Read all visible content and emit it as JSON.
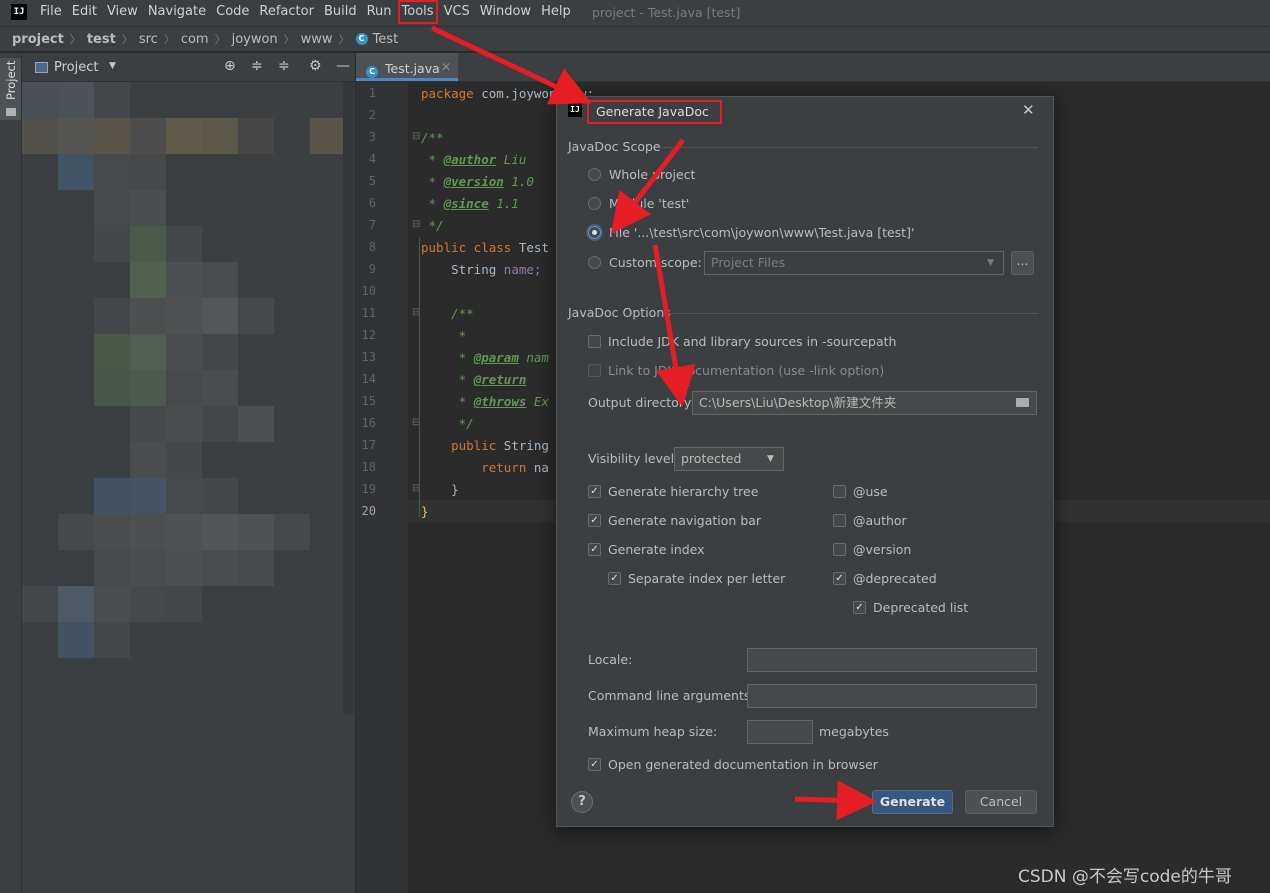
{
  "menubar": {
    "items": [
      "File",
      "Edit",
      "View",
      "Navigate",
      "Code",
      "Refactor",
      "Build",
      "Run",
      "Tools",
      "VCS",
      "Window",
      "Help"
    ],
    "window_title": "project - Test.java [test]"
  },
  "breadcrumb": {
    "items": [
      "project",
      "test",
      "src",
      "com",
      "joywon",
      "www",
      "Test"
    ]
  },
  "project_panel": {
    "tab_label": "Project",
    "title": "Project"
  },
  "editor": {
    "tab_label": "Test.java",
    "lines": [
      {
        "n": "1",
        "text": "package com.joywon.www;"
      },
      {
        "n": "2",
        "text": ""
      },
      {
        "n": "3",
        "text": "/**"
      },
      {
        "n": "4",
        "tag": "@author",
        "rest": " Liu"
      },
      {
        "n": "5",
        "tag": "@version",
        "rest": " 1.0"
      },
      {
        "n": "6",
        "tag": "@since",
        "rest": " 1.1"
      },
      {
        "n": "7",
        "text": " */"
      },
      {
        "n": "8",
        "kw": "public class",
        "rest": " Test"
      },
      {
        "n": "9",
        "type": "    String",
        "field": " name;"
      },
      {
        "n": "10",
        "text": ""
      },
      {
        "n": "11",
        "text": "    /**"
      },
      {
        "n": "12",
        "text": "     *"
      },
      {
        "n": "13",
        "tag": "@param",
        "rest": " nam"
      },
      {
        "n": "14",
        "tag": "@return",
        "rest": ""
      },
      {
        "n": "15",
        "tag": "@throws",
        "rest": " Ex"
      },
      {
        "n": "16",
        "text": "     */"
      },
      {
        "n": "17",
        "kw": "    public",
        "rest": " String"
      },
      {
        "n": "18",
        "kw": "        return",
        "rest": " na"
      },
      {
        "n": "19",
        "text": "    }"
      },
      {
        "n": "20",
        "text": "}"
      }
    ]
  },
  "dialog": {
    "title": "Generate JavaDoc",
    "scope_section": "JavaDoc Scope",
    "scope_options": [
      {
        "label": "Whole project",
        "selected": false
      },
      {
        "label": "Module 'test'",
        "selected": false
      },
      {
        "label": "File '...\\test\\src\\com\\joywon\\www\\Test.java [test]'",
        "selected": true
      },
      {
        "label": "Custom scope:",
        "selected": false
      }
    ],
    "custom_scope_value": "Project Files",
    "options_section": "JavaDoc Options",
    "include_jdk": "Include JDK and library sources in -sourcepath",
    "link_jdk": "Link to JDK documentation (use -link option)",
    "output_label": "Output directory:",
    "output_value": "C:\\Users\\Liu\\Desktop\\新建文件夹",
    "visibility_label": "Visibility level:",
    "visibility_value": "protected",
    "left_checks": [
      {
        "label": "Generate hierarchy tree",
        "checked": true
      },
      {
        "label": "Generate navigation bar",
        "checked": true
      },
      {
        "label": "Generate index",
        "checked": true
      },
      {
        "label": "Separate index per letter",
        "checked": true
      }
    ],
    "right_checks": [
      {
        "label": "@use",
        "checked": false
      },
      {
        "label": "@author",
        "checked": false
      },
      {
        "label": "@version",
        "checked": false
      },
      {
        "label": "@deprecated",
        "checked": true
      },
      {
        "label": "Deprecated list",
        "checked": true
      }
    ],
    "locale_label": "Locale:",
    "cmd_label": "Command line arguments:",
    "heap_label": "Maximum heap size:",
    "heap_unit": "megabytes",
    "open_browser": "Open generated documentation in browser",
    "generate_label": "Generate",
    "cancel_label": "Cancel",
    "help_label": "?",
    "browse_label": "..."
  },
  "watermark": "CSDN @不会写code的牛哥",
  "colors": {
    "annotation": "#e51d25",
    "accent": "#4a88c7",
    "primary_button": "#365880"
  }
}
